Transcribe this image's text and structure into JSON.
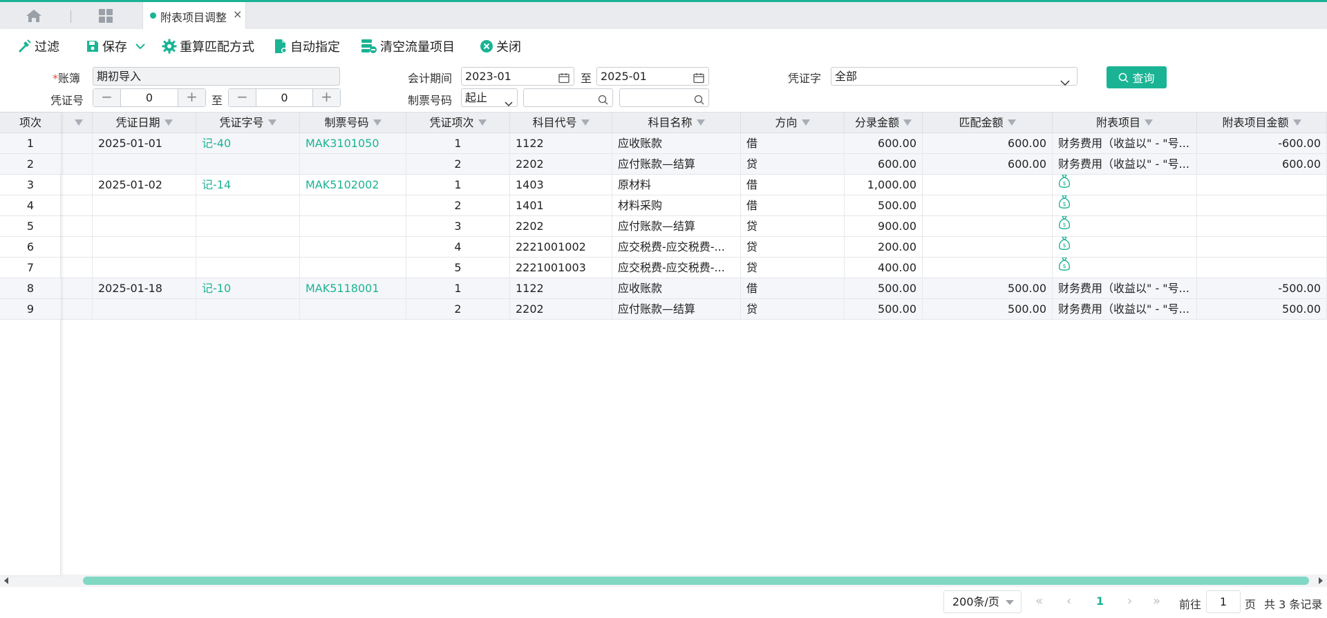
{
  "tabs": {
    "active_title": "附表项目调整",
    "close_glyph": "×"
  },
  "toolbar": {
    "filter": "过滤",
    "save": "保存",
    "recalc": "重算匹配方式",
    "auto_assign": "自动指定",
    "clear_flow": "清空流量项目",
    "close": "关闭"
  },
  "form": {
    "ledger_label": "账簿",
    "ledger_required": "*",
    "ledger_value": "期初导入",
    "voucher_no_label": "凭证号",
    "voucher_no_from": "0",
    "voucher_no_to": "0",
    "to_text": "至",
    "period_label": "会计期间",
    "period_from": "2023-01",
    "period_to": "2025-01",
    "ticket_label": "制票号码",
    "ticket_mode": "起止",
    "ticket_from": "",
    "ticket_to": "",
    "voucher_word_label": "凭证字",
    "voucher_word_value": "全部",
    "query_button": "查询"
  },
  "table": {
    "index_header": "项次",
    "columns": [
      "凭证日期",
      "凭证字号",
      "制票号码",
      "凭证项次",
      "科目代号",
      "科目名称",
      "方向",
      "分录金额",
      "匹配金额",
      "附表项目",
      "附表项目金额"
    ],
    "rows": [
      {
        "idx": "1",
        "date": "2025-01-01",
        "word": "记-40",
        "ticket": "MAK3101050",
        "seq": "1",
        "code": "1122",
        "name": "应收账款",
        "dir": "借",
        "amount": "600.00",
        "match": "600.00",
        "item": "财务费用（收益以\" - \"号...",
        "item_amount": "-600.00",
        "icon": false
      },
      {
        "idx": "2",
        "date": "",
        "word": "",
        "ticket": "",
        "seq": "2",
        "code": "2202",
        "name": "应付账款—结算",
        "dir": "贷",
        "amount": "600.00",
        "match": "600.00",
        "item": "财务费用（收益以\" - \"号...",
        "item_amount": "600.00",
        "icon": false
      },
      {
        "idx": "3",
        "date": "2025-01-02",
        "word": "记-14",
        "ticket": "MAK5102002",
        "seq": "1",
        "code": "1403",
        "name": "原材料",
        "dir": "借",
        "amount": "1,000.00",
        "match": "",
        "item": "",
        "item_amount": "",
        "icon": true
      },
      {
        "idx": "4",
        "date": "",
        "word": "",
        "ticket": "",
        "seq": "2",
        "code": "1401",
        "name": "材料采购",
        "dir": "借",
        "amount": "500.00",
        "match": "",
        "item": "",
        "item_amount": "",
        "icon": true
      },
      {
        "idx": "5",
        "date": "",
        "word": "",
        "ticket": "",
        "seq": "3",
        "code": "2202",
        "name": "应付账款—结算",
        "dir": "贷",
        "amount": "900.00",
        "match": "",
        "item": "",
        "item_amount": "",
        "icon": true
      },
      {
        "idx": "6",
        "date": "",
        "word": "",
        "ticket": "",
        "seq": "4",
        "code": "2221001002",
        "name": "应交税费-应交税费-...",
        "dir": "贷",
        "amount": "200.00",
        "match": "",
        "item": "",
        "item_amount": "",
        "icon": true
      },
      {
        "idx": "7",
        "date": "",
        "word": "",
        "ticket": "",
        "seq": "5",
        "code": "2221001003",
        "name": "应交税费-应交税费-...",
        "dir": "贷",
        "amount": "400.00",
        "match": "",
        "item": "",
        "item_amount": "",
        "icon": true
      },
      {
        "idx": "8",
        "date": "2025-01-18",
        "word": "记-10",
        "ticket": "MAK5118001",
        "seq": "1",
        "code": "1122",
        "name": "应收账款",
        "dir": "借",
        "amount": "500.00",
        "match": "500.00",
        "item": "财务费用（收益以\" - \"号...",
        "item_amount": "-500.00",
        "icon": false
      },
      {
        "idx": "9",
        "date": "",
        "word": "",
        "ticket": "",
        "seq": "2",
        "code": "2202",
        "name": "应付账款—结算",
        "dir": "贷",
        "amount": "500.00",
        "match": "500.00",
        "item": "财务费用（收益以\" - \"号...",
        "item_amount": "500.00",
        "icon": false
      }
    ]
  },
  "pager": {
    "page_size": "200条/页",
    "current_page": "1",
    "goto_label": "前往",
    "goto_value": "1",
    "page_unit": "页",
    "total_text": "共 3 条记录"
  },
  "colors": {
    "accent": "#1ab394",
    "row_shade": "#f4f6f9",
    "header_bg": "#eceef1"
  }
}
